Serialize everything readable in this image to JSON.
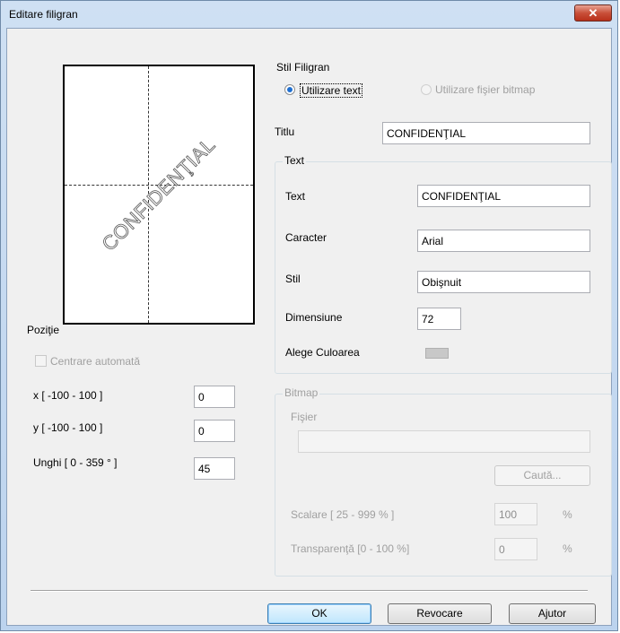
{
  "window": {
    "title": "Editare filigran",
    "close_label": "✕"
  },
  "preview": {
    "watermark_text": "CONFIDENŢIAL"
  },
  "position": {
    "group_label": "Poziţie",
    "auto_center_label": "Centrare automată",
    "auto_center_checked": false,
    "x_label": "x [ -100  -  100 ]",
    "x_value": "0",
    "y_label": "y [ -100  -  100 ]",
    "y_value": "0",
    "angle_label": "Unghi [ 0 - 359 ° ]",
    "angle_value": "45"
  },
  "style": {
    "group_label": "Stil Filigran",
    "use_text_label": "Utilizare text",
    "use_bitmap_label": "Utilizare fişier bitmap",
    "selected": "text"
  },
  "title_field": {
    "label": "Titlu",
    "value": "CONFIDENŢIAL"
  },
  "text_group": {
    "label": "Text",
    "text_label": "Text",
    "text_value": "CONFIDENŢIAL",
    "char_label": "Caracter",
    "char_value": "Arial",
    "style_label": "Stil",
    "style_value": "Obişnuit",
    "size_label": "Dimensiune",
    "size_value": "72",
    "color_label": "Alege Culoarea",
    "color_value": "#c8c8c8"
  },
  "bitmap_group": {
    "label": "Bitmap",
    "file_label": "Fişier",
    "file_value": "",
    "browse_label": "Caută...",
    "scale_label": "Scalare [ 25 - 999 % ]",
    "scale_value": "100",
    "scale_unit": "%",
    "transparency_label": "Transparenţă [0 - 100 %]",
    "transparency_value": "0",
    "transparency_unit": "%"
  },
  "buttons": {
    "ok": "OK",
    "cancel": "Revocare",
    "help": "Ajutor"
  }
}
